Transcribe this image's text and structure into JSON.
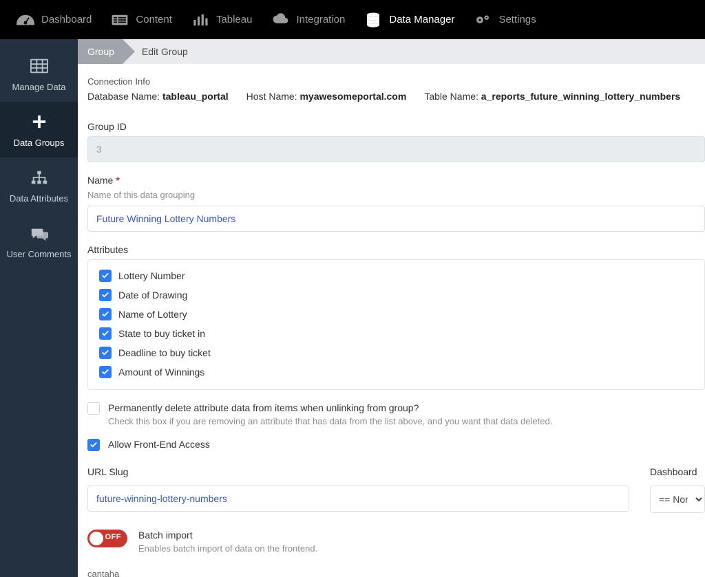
{
  "topnav": [
    {
      "label": "Dashboard",
      "icon": "gauge",
      "active": false
    },
    {
      "label": "Content",
      "icon": "list",
      "active": false
    },
    {
      "label": "Tableau",
      "icon": "bars",
      "active": false
    },
    {
      "label": "Integration",
      "icon": "cloud",
      "active": false
    },
    {
      "label": "Data Manager",
      "icon": "database",
      "active": true
    },
    {
      "label": "Settings",
      "icon": "gears",
      "active": false
    }
  ],
  "sidebar": [
    {
      "label": "Manage Data",
      "icon": "table",
      "active": false
    },
    {
      "label": "Data Groups",
      "icon": "plus",
      "active": true
    },
    {
      "label": "Data Attributes",
      "icon": "sitemap",
      "active": false
    },
    {
      "label": "User Comments",
      "icon": "comments",
      "active": false
    }
  ],
  "breadcrumb": {
    "first": "Group",
    "second": "Edit Group"
  },
  "connection": {
    "heading": "Connection Info",
    "db_label": "Database Name:",
    "db_value": "tableau_portal",
    "host_label": "Host Name:",
    "host_value": "myawesomeportal.com",
    "table_label": "Table Name:",
    "table_value": "a_reports_future_winning_lottery_numbers"
  },
  "group_id": {
    "label": "Group ID",
    "value": "3"
  },
  "name": {
    "label": "Name",
    "required_mark": "*",
    "hint": "Name of this data grouping",
    "value": "Future Winning Lottery Numbers"
  },
  "attributes": {
    "label": "Attributes",
    "items": [
      {
        "label": "Lottery Number",
        "checked": true
      },
      {
        "label": "Date of Drawing",
        "checked": true
      },
      {
        "label": "Name of Lottery",
        "checked": true
      },
      {
        "label": "State to buy ticket in",
        "checked": true
      },
      {
        "label": "Deadline to buy ticket",
        "checked": true
      },
      {
        "label": "Amount of Winnings",
        "checked": true
      }
    ]
  },
  "perm_delete": {
    "checked": false,
    "title": "Permanently delete attribute data from items when unlinking from group?",
    "sub": "Check this box if you are removing an attribute that has data from the list above, and you want that data deleted."
  },
  "front_access": {
    "checked": true,
    "label": "Allow Front-End Access"
  },
  "url_slug": {
    "label": "URL Slug",
    "value": "future-winning-lottery-numbers"
  },
  "dashboard": {
    "label": "Dashboard",
    "selected": "== None"
  },
  "batch_import": {
    "state": "OFF",
    "title": "Batch import",
    "sub": "Enables batch import of data on the frontend."
  },
  "bottom_hint": "cantaha"
}
